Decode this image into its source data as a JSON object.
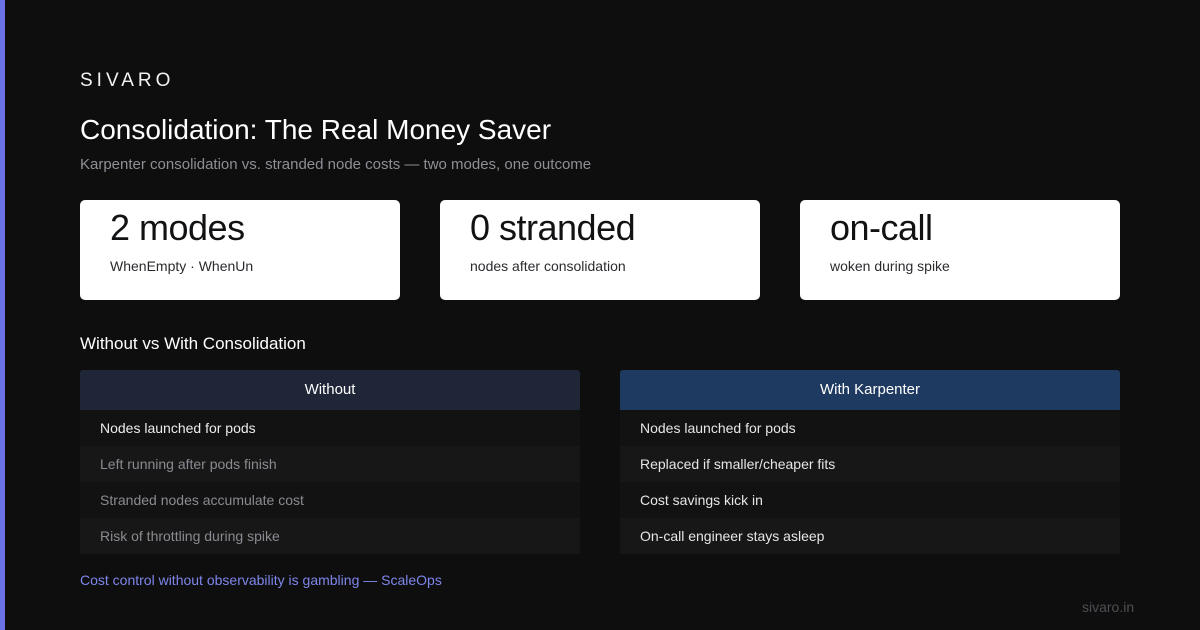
{
  "brand": "SIVARO",
  "title": "Consolidation: The Real Money Saver",
  "subtitle": "Karpenter consolidation vs. stranded node costs — two modes, one outcome",
  "stats": [
    {
      "value": "2 modes",
      "label": "WhenEmpty · WhenUn"
    },
    {
      "value": "0 stranded",
      "label": "nodes after consolidation"
    },
    {
      "value": "on-call",
      "label": "woken during spike"
    }
  ],
  "comparison": {
    "title": "Without vs With Consolidation",
    "without": {
      "header": "Without",
      "rows": [
        "Nodes launched for pods",
        "Left running after pods finish",
        "Stranded nodes accumulate cost",
        "Risk of throttling during spike"
      ]
    },
    "with": {
      "header": "With Karpenter",
      "rows": [
        "Nodes launched for pods",
        "Replaced if smaller/cheaper fits",
        "Cost savings kick in",
        "On-call engineer stays asleep"
      ]
    }
  },
  "quote": "Cost control without observability is gambling — ScaleOps",
  "site": "sivaro.in",
  "colors": {
    "accent": "#6b72e8",
    "background": "#0e0e0f",
    "card": "#ffffff",
    "without_header": "#1e2638",
    "with_header": "#1f3a60",
    "muted_text": "#8e8f96",
    "quote": "#7f86ea"
  }
}
